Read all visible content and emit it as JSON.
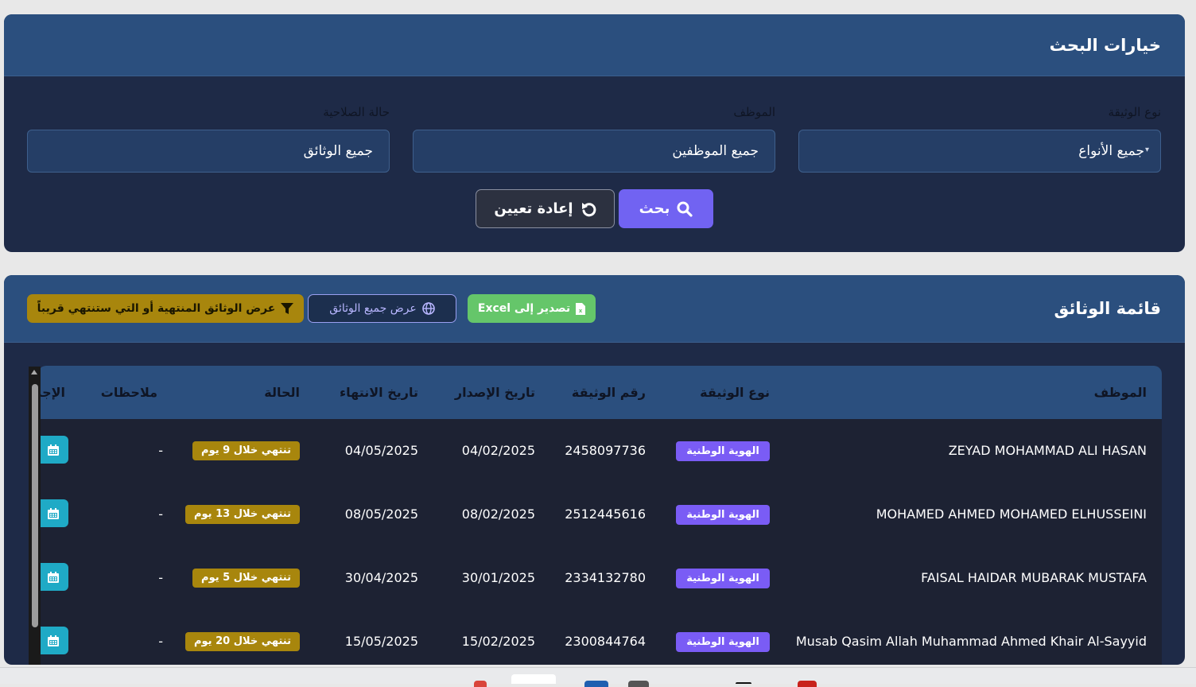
{
  "search": {
    "title": "خيارات البحث",
    "fields": [
      {
        "label": "نوع الوثيقة",
        "value": "جميع الأنواع"
      },
      {
        "label": "الموظف",
        "value": "جميع الموظفين"
      },
      {
        "label": "حالة الصلاحية",
        "value": "جميع الوثائق"
      }
    ],
    "search_button": "بحث",
    "reset_button": "إعادة تعيين"
  },
  "documents": {
    "title": "قائمة الوثائق",
    "export_button": "تصدير إلى Excel",
    "show_all_button": "عرض جميع الوثائق",
    "show_expiring_button": "عرض الوثائق المنتهية أو التي ستنتهي قريباً",
    "columns": {
      "employee": "الموظف",
      "doc_type": "نوع الوثيقة",
      "doc_number": "رقم الوثيقة",
      "issue_date": "تاريخ الإصدار",
      "expiry_date": "تاريخ الانتهاء",
      "status": "الحالة",
      "notes": "ملاحظات",
      "actions": "الإجراءات"
    },
    "rows": [
      {
        "employee": "ZEYAD MOHAMMAD ALI HASAN",
        "doc_type": "الهوية الوطنية",
        "doc_number": "2458097736",
        "issue_date": "04/02/2025",
        "expiry_date": "04/05/2025",
        "status": "تنتهي خلال 9 يوم",
        "notes": "-"
      },
      {
        "employee": "MOHAMED AHMED MOHAMED ELHUSSEINI",
        "doc_type": "الهوية الوطنية",
        "doc_number": "2512445616",
        "issue_date": "08/02/2025",
        "expiry_date": "08/05/2025",
        "status": "تنتهي خلال 13 يوم",
        "notes": "-"
      },
      {
        "employee": "FAISAL HAIDAR MUBARAK MUSTAFA",
        "doc_type": "الهوية الوطنية",
        "doc_number": "2334132780",
        "issue_date": "30/01/2025",
        "expiry_date": "30/04/2025",
        "status": "تنتهي خلال 5 يوم",
        "notes": "-"
      },
      {
        "employee": "Musab Qasim Allah Muhammad Ahmed Khair Al-Sayyid",
        "doc_type": "الهوية الوطنية",
        "doc_number": "2300844764",
        "issue_date": "15/02/2025",
        "expiry_date": "15/05/2025",
        "status": "تنتهي خلال 20 يوم",
        "notes": "-"
      }
    ]
  },
  "colors": {
    "header_blue": "#2b4f7e",
    "card_bg": "#1e2a47",
    "primary_purple": "#7163f2",
    "excel_green": "#65c66a",
    "warning_gold": "#a8860d",
    "action_cyan": "#1faac6"
  }
}
